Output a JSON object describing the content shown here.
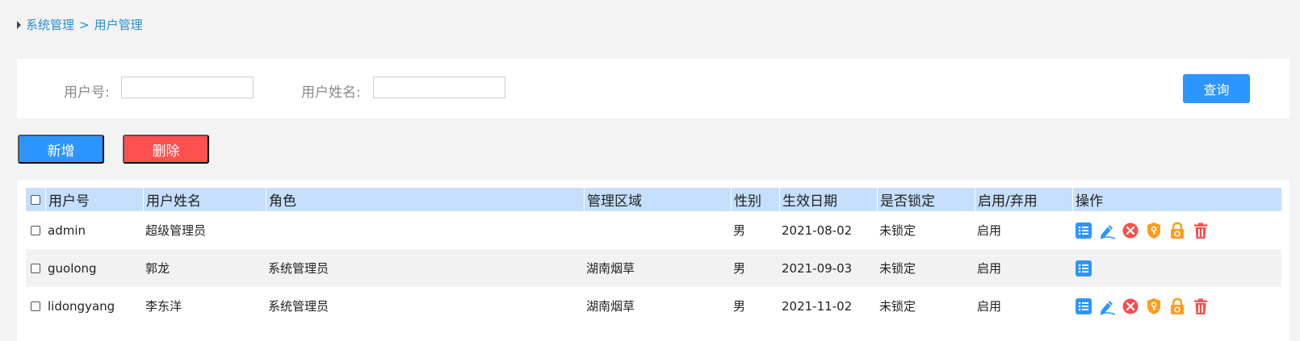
{
  "breadcrumb": {
    "root": "系统管理",
    "separator": ">",
    "current": "用户管理"
  },
  "filters": {
    "user_id_label": "用户号:",
    "user_id_value": "",
    "user_name_label": "用户姓名:",
    "user_name_value": "",
    "query_label": "查询"
  },
  "actions": {
    "add_label": "新增",
    "delete_label": "删除"
  },
  "table": {
    "headers": [
      "用户号",
      "用户姓名",
      "角色",
      "管理区域",
      "性别",
      "生效日期",
      "是否锁定",
      "启用/弃用",
      "操作"
    ],
    "rows": [
      {
        "id": "admin",
        "name": "超级管理员",
        "role": "",
        "area": "",
        "gender": "男",
        "date": "2021-08-02",
        "locked": "未锁定",
        "enabled": "启用",
        "ops": [
          "list-icon",
          "edit-icon",
          "disable-icon",
          "reset-password-icon",
          "lock-icon",
          "trash-icon"
        ]
      },
      {
        "id": "guolong",
        "name": "郭龙",
        "role": "系统管理员",
        "area": "湖南烟草",
        "gender": "男",
        "date": "2021-09-03",
        "locked": "未锁定",
        "enabled": "启用",
        "ops": [
          "list-icon"
        ]
      },
      {
        "id": "lidongyang",
        "name": "李东洋",
        "role": "系统管理员",
        "area": "湖南烟草",
        "gender": "男",
        "date": "2021-11-02",
        "locked": "未锁定",
        "enabled": "启用",
        "ops": [
          "list-icon",
          "edit-icon",
          "disable-icon",
          "reset-password-icon",
          "lock-icon",
          "trash-icon"
        ]
      }
    ]
  },
  "colors": {
    "primary": "#2d95ff",
    "danger": "#ff5050",
    "header_bg": "#c6dffc",
    "link": "#2a8fd0",
    "orange": "#ff9d1b",
    "red": "#f4504f"
  }
}
